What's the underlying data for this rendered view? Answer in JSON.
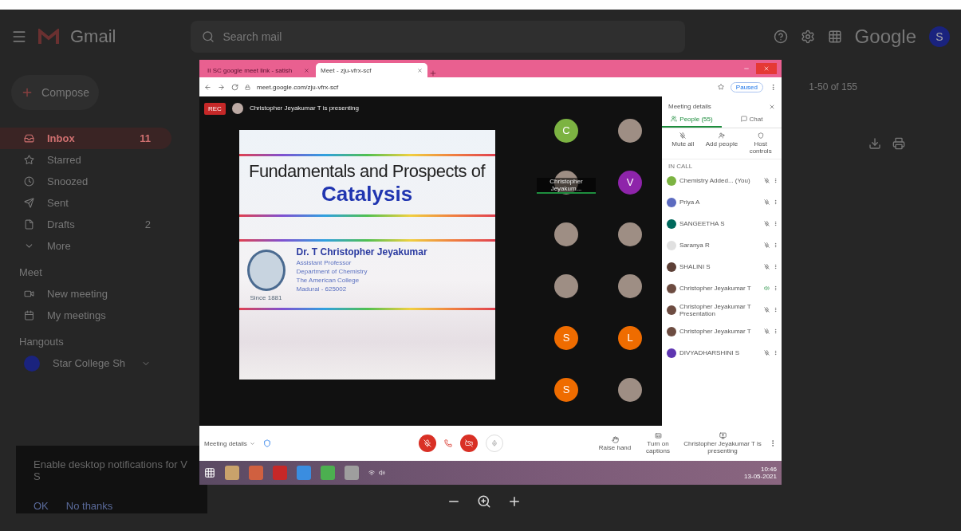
{
  "gmail": {
    "brand": "Gmail",
    "search_placeholder": "Search mail",
    "account_text": "Google",
    "account_letter": "S",
    "compose": "Compose",
    "page_count": "1-50 of 155",
    "nav": [
      {
        "label": "Inbox",
        "count": "11",
        "selected": true
      },
      {
        "label": "Starred",
        "selected": false
      },
      {
        "label": "Snoozed",
        "selected": false
      },
      {
        "label": "Sent",
        "selected": false
      },
      {
        "label": "Drafts",
        "count": "2",
        "selected": false
      },
      {
        "label": "More",
        "selected": false
      }
    ],
    "meet_heading": "Meet",
    "meet_items": [
      "New meeting",
      "My meetings"
    ],
    "hangouts_heading": "Hangouts",
    "hangouts_user": "Star College Sh",
    "notification": {
      "text": "Enable desktop notifications for V S",
      "actions": [
        "OK",
        "No thanks"
      ]
    }
  },
  "meet_window": {
    "tabs": [
      {
        "label": "II SC google meet link - satish",
        "selected": false
      },
      {
        "label": "Meet - zju-vfrx-scf",
        "selected": true
      }
    ],
    "url": "meet.google.com/zju-vfrx-scf",
    "profile": "Paused",
    "rec_badge": "REC",
    "presenter_text": "Christopher Jeyakumar T is presenting",
    "slide": {
      "title_line1": "Fundamentals and Prospects of",
      "title_line2": "Catalysis",
      "author": "Dr. T Christopher Jeyakumar",
      "lines": [
        "Assistant Professor",
        "Department of Chemistry",
        "The American College",
        "Madurai - 625002"
      ],
      "seal_text": "Since 1881"
    },
    "tiles": [
      {
        "kind": "letter",
        "letter": "C",
        "color": "#7cb342"
      },
      {
        "kind": "photo"
      },
      {
        "kind": "photo",
        "label": "Christopher Jeyakum..."
      },
      {
        "kind": "letter",
        "letter": "V",
        "color": "#8e24aa"
      },
      {
        "kind": "photo"
      },
      {
        "kind": "photo"
      },
      {
        "kind": "photo"
      },
      {
        "kind": "photo"
      },
      {
        "kind": "letter",
        "letter": "S",
        "color": "#ef6c00"
      },
      {
        "kind": "letter",
        "letter": "L",
        "color": "#ef6c00"
      },
      {
        "kind": "letter",
        "letter": "S",
        "color": "#ef6c00"
      },
      {
        "kind": "photo"
      }
    ],
    "panel": {
      "title": "Meeting details",
      "tabs": [
        {
          "label": "People (55)",
          "selected": true
        },
        {
          "label": "Chat",
          "selected": false
        }
      ],
      "actions": [
        "Mute all",
        "Add people",
        "Host controls"
      ],
      "section": "IN CALL",
      "people": [
        {
          "name": "Chemistry Added... (You)",
          "color": "#7cb342"
        },
        {
          "name": "Priya A",
          "color": "#5c6bc0"
        },
        {
          "name": "SANGEETHA S",
          "color": "#00695c"
        },
        {
          "name": "Saranya R",
          "color": "#e0e0e0"
        },
        {
          "name": "SHALINI S",
          "color": "#5d4037"
        },
        {
          "name": "Christopher Jeyakumar T",
          "color": "#6d4c41",
          "speaking": true
        },
        {
          "name": "Christopher Jeyakumar T",
          "sub": "Presentation",
          "color": "#6d4c41",
          "speaking": false
        },
        {
          "name": "Christopher Jeyakumar T",
          "color": "#6d4c41",
          "speaking": false
        },
        {
          "name": "DIVYADHARSHINI S",
          "color": "#5e35b1",
          "speaking": false
        }
      ]
    },
    "bottom": {
      "details": "Meeting details",
      "actions": [
        "Raise hand",
        "Turn on captions",
        "Christopher Jeyakumar T is presenting"
      ]
    },
    "taskbar": {
      "time": "10:46",
      "date": "13-05-2021"
    }
  }
}
